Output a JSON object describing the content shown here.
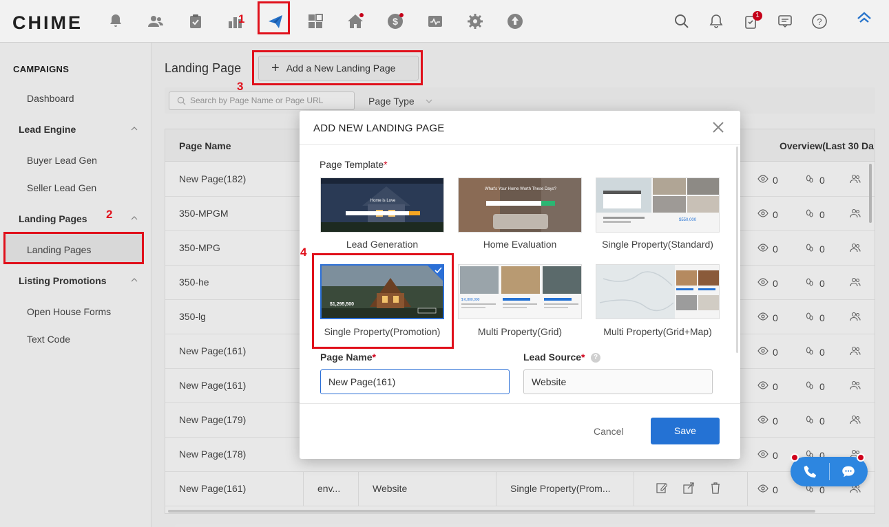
{
  "brand": {
    "logo": "CHIME"
  },
  "topnav": {
    "notification_badge": "1"
  },
  "sidebar": {
    "title": "CAMPAIGNS",
    "dashboard": "Dashboard",
    "groups": [
      {
        "label": "Lead Engine",
        "items": [
          "Buyer Lead Gen",
          "Seller Lead Gen"
        ]
      },
      {
        "label": "Landing Pages",
        "items": [
          "Landing Pages"
        ]
      },
      {
        "label": "Listing Promotions",
        "items": [
          "Open House Forms",
          "Text Code"
        ]
      }
    ]
  },
  "main": {
    "title": "Landing Page",
    "add_button": "Add a New Landing Page",
    "search_placeholder": "Search by Page Name or Page URL",
    "page_type_label": "Page Type",
    "table": {
      "col_name": "Page Name",
      "col_overview": "Overview(Last 30 Da",
      "rows": [
        {
          "name": "New Page(182)",
          "views": "0",
          "visits": "0"
        },
        {
          "name": "350-MPGM",
          "views": "0",
          "visits": "0"
        },
        {
          "name": "350-MPG",
          "views": "0",
          "visits": "0"
        },
        {
          "name": "350-he",
          "views": "0",
          "visits": "0"
        },
        {
          "name": "350-lg",
          "views": "0",
          "visits": "0"
        },
        {
          "name": "New Page(161)",
          "views": "0",
          "visits": "0"
        },
        {
          "name": "New Page(161)",
          "views": "0",
          "visits": "0"
        },
        {
          "name": "New Page(179)",
          "views": "0",
          "visits": "0"
        },
        {
          "name": "New Page(178)",
          "views": "0",
          "visits": "0"
        },
        {
          "name": "New Page(161)",
          "views": "0",
          "visits": "0",
          "author": "env...",
          "lead_source": "Website",
          "template": "Single Property(Prom..."
        }
      ]
    }
  },
  "modal": {
    "title": "ADD NEW LANDING PAGE",
    "template_label": "Page Template",
    "required_mark": "*",
    "templates": [
      {
        "name": "Lead Generation",
        "preview_text": "Home is Love"
      },
      {
        "name": "Home Evaluation",
        "preview_text": "What's Your Home Worth These Days?"
      },
      {
        "name": "Single Property(Standard)",
        "preview_text": "$550,000"
      },
      {
        "name": "Single Property(Promotion)",
        "preview_text": "$1,295,500",
        "selected": true
      },
      {
        "name": "Multi Property(Grid)",
        "preview_text": "$ 6,800,000"
      },
      {
        "name": "Multi Property(Grid+Map)",
        "preview_text": ""
      }
    ],
    "page_name_label": "Page Name",
    "page_name_value": "New Page(161)",
    "lead_source_label": "Lead Source",
    "lead_source_value": "Website",
    "help_glyph": "?",
    "cancel": "Cancel",
    "save": "Save"
  },
  "annotations": {
    "n1": "1",
    "n2": "2",
    "n3": "3",
    "n4": "4",
    "color": "#e0101b"
  }
}
